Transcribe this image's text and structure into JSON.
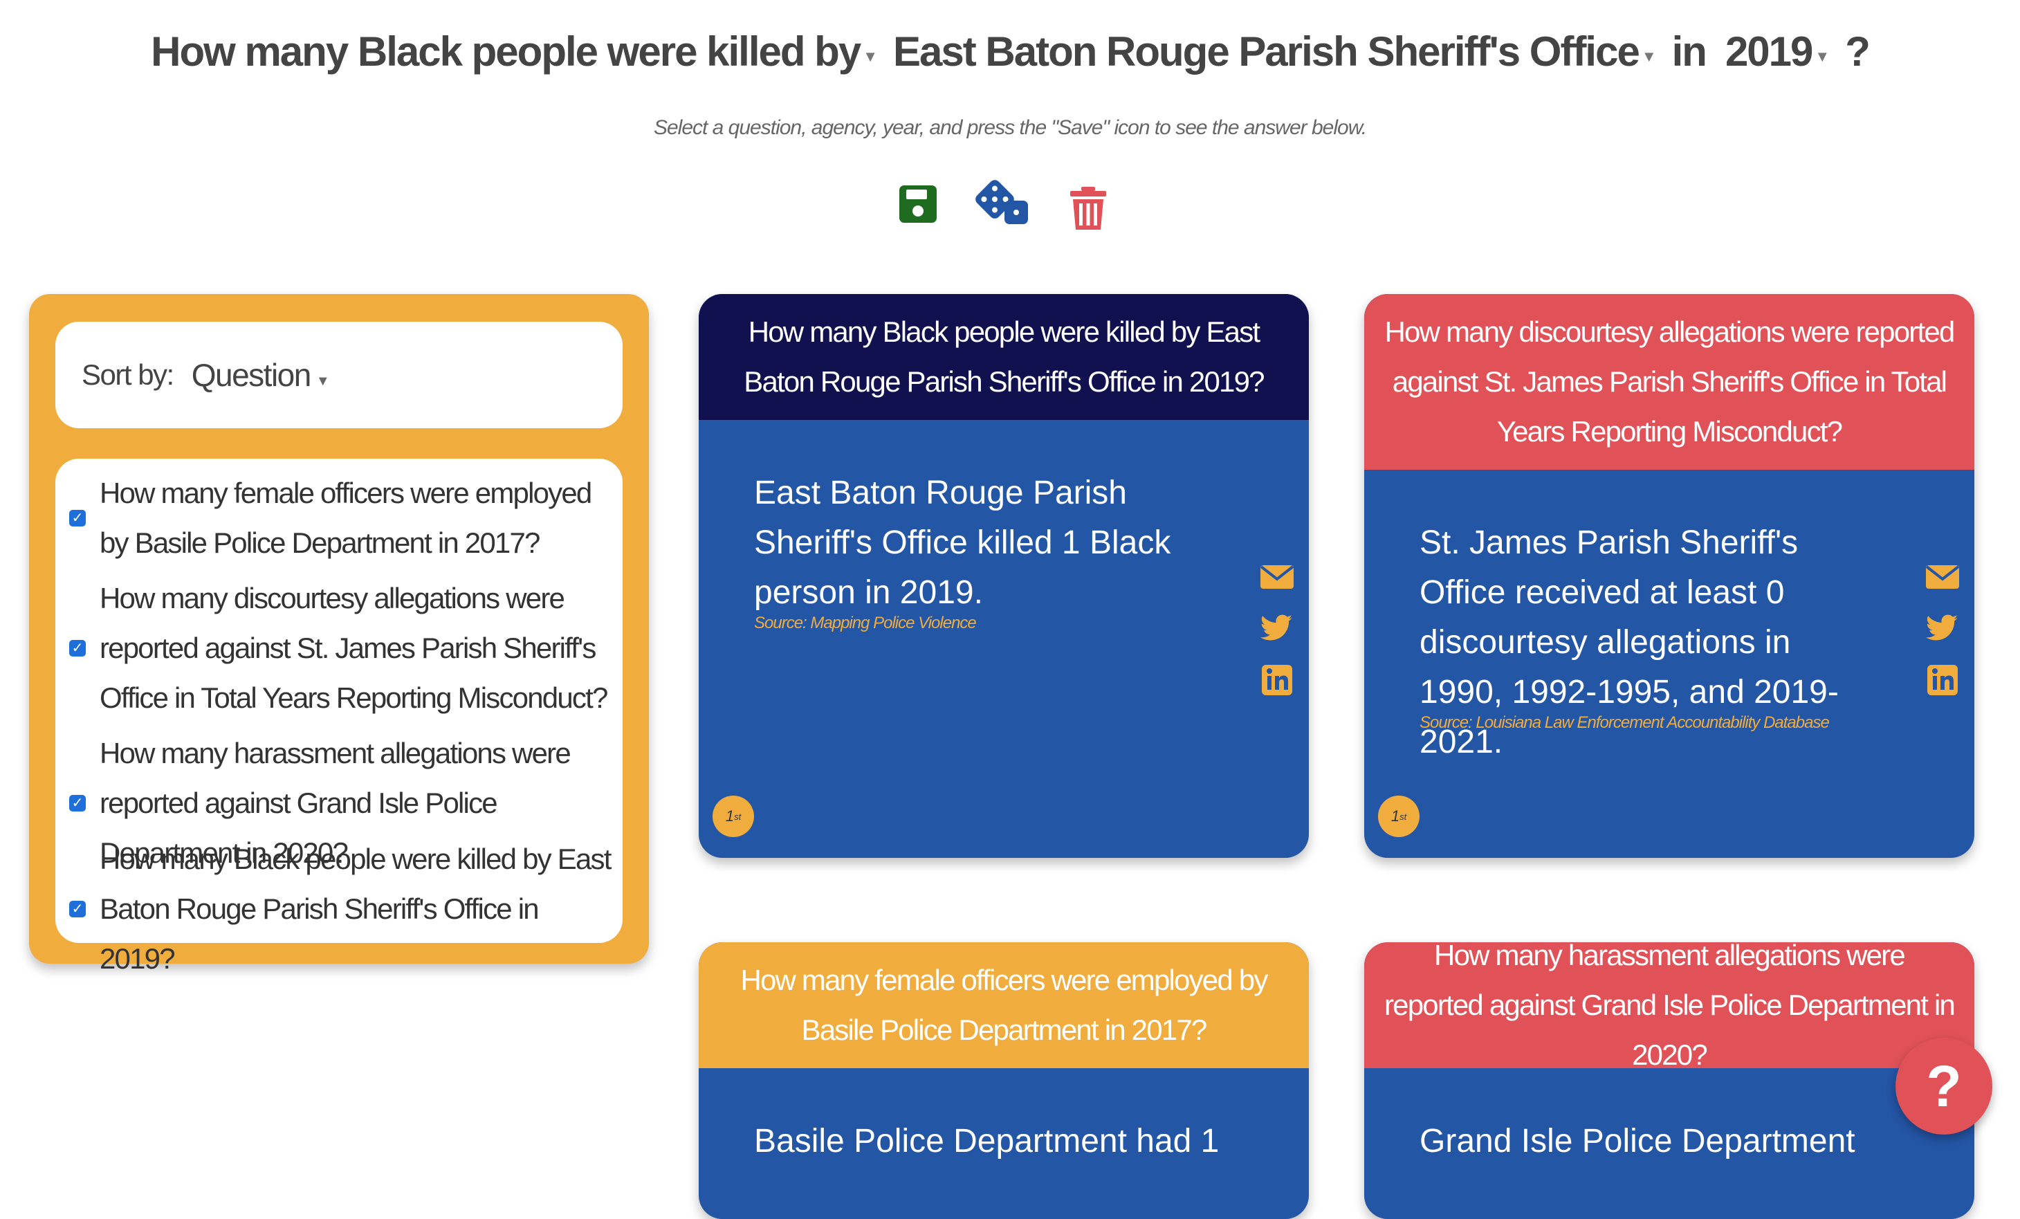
{
  "header": {
    "question": "How many Black people were killed by",
    "agency": "East Baton Rouge Parish Sheriff's Office",
    "in_word": "in",
    "year": "2019",
    "end": "?",
    "subtitle": "Select a question, agency, year, and press the \"Save\" icon to see the answer below."
  },
  "toolbar": {
    "save_icon": "floppy-disk-icon",
    "random_icon": "dice-icon",
    "delete_icon": "trash-icon",
    "colors": {
      "save": "#1f6b1f",
      "random": "#2456a6",
      "delete": "#e05258"
    }
  },
  "sidebar": {
    "sort_label": "Sort by:",
    "sort_value": "Question",
    "items": [
      {
        "text": "How many female officers were employed by Basile Police Department in 2017?",
        "checked": true
      },
      {
        "text": "How many discourtesy allegations were reported against St. James Parish Sheriff's Office in Total Years Reporting Misconduct?",
        "checked": true
      },
      {
        "text": "How many harassment allegations were reported against Grand Isle Police Department in 2020?",
        "checked": true
      },
      {
        "text": "How many Black people were killed by East Baton Rouge Parish Sheriff's Office in 2019?",
        "checked": true
      }
    ]
  },
  "cards": [
    {
      "title": "How many Black people were killed by East Baton Rouge Parish Sheriff's Office in 2019?",
      "answer": "East Baton Rouge Parish Sheriff's Office killed 1 Black person in 2019.",
      "source": "Source: Mapping Police Violence",
      "rank": "1",
      "rank_suffix": "st",
      "header_color": "#121150"
    },
    {
      "title": "How many discourtesy allegations were reported against St. James Parish Sheriff's Office in Total Years Reporting Misconduct?",
      "answer": "St. James Parish Sheriff's Office received at least 0 discourtesy allegations in 1990, 1992-1995, and 2019-2021.",
      "source": "Source: Louisiana Law Enforcement Accountability Database",
      "rank": "1",
      "rank_suffix": "st",
      "header_color": "#e05258"
    },
    {
      "title": "How many female officers were employed by Basile Police Department in 2017?",
      "answer": "Basile Police Department had 1",
      "header_color": "#f0ad3e"
    },
    {
      "title": "How many harassment allegations were reported against Grand Isle Police Department in 2020?",
      "answer": "Grand Isle Police Department",
      "header_color": "#e05258"
    }
  ],
  "share_icons": [
    "envelope-icon",
    "twitter-icon",
    "linkedin-icon"
  ],
  "help_label": "?",
  "colors": {
    "accent": "#f0ad3e",
    "card_body": "#2456a6",
    "red": "#e05258",
    "navy": "#121150"
  }
}
